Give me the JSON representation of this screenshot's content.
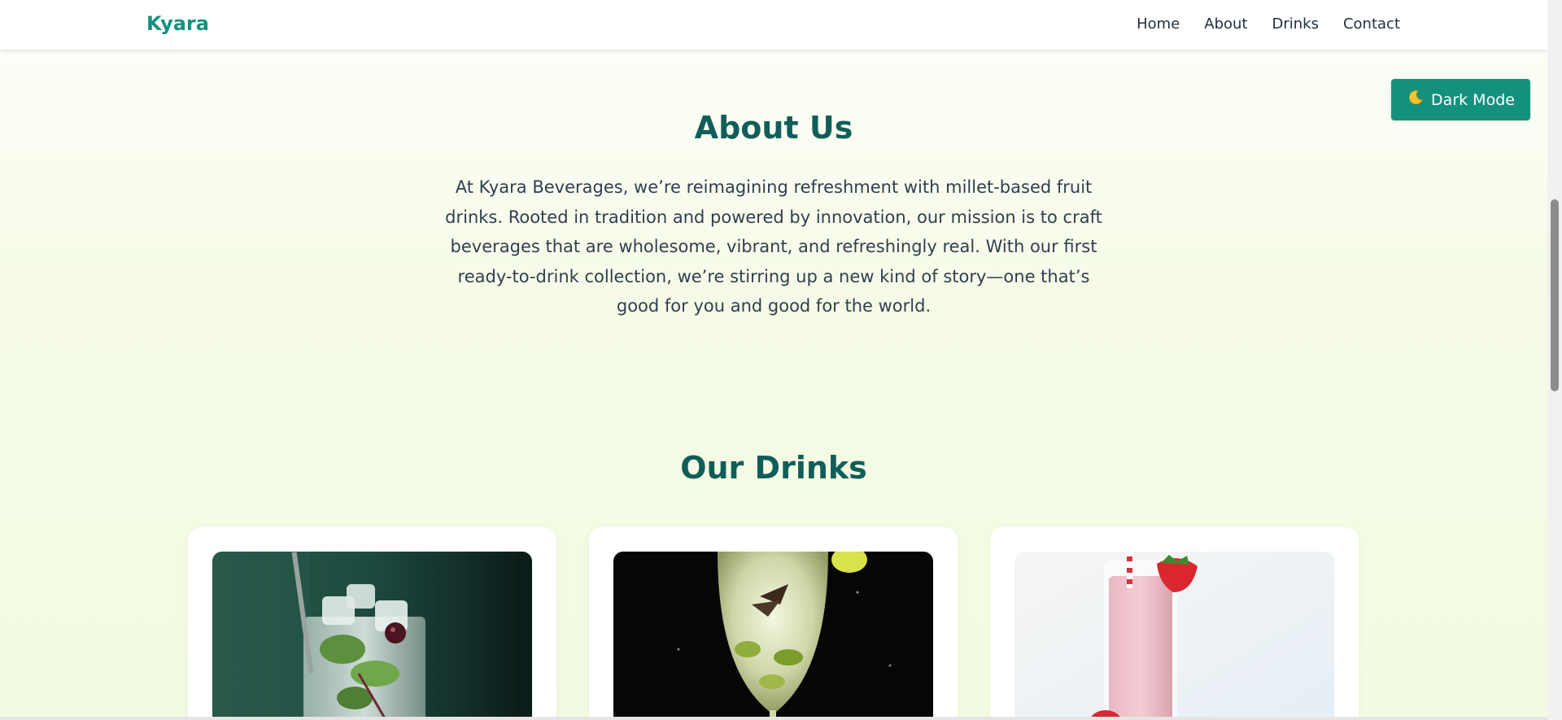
{
  "nav": {
    "brand": "Kyara",
    "links": [
      "Home",
      "About",
      "Drinks",
      "Contact"
    ]
  },
  "theme_toggle": {
    "icon": "moon-icon",
    "label": "Dark Mode"
  },
  "about": {
    "title": "About Us",
    "text": "At Kyara Beverages, we’re reimagining refreshment with millet-based fruit drinks. Rooted in tradition and powered by innovation, our mission is to craft beverages that are wholesome, vibrant, and refreshingly real. With our first ready-to-drink collection, we’re stirring up a new kind of story—one that’s good for you and good for the world."
  },
  "drinks": {
    "title": "Our Drinks",
    "cards": [
      {
        "image": "mint-mojito-glass-image"
      },
      {
        "image": "lime-cocktail-glass-image"
      },
      {
        "image": "strawberry-smoothie-image"
      }
    ]
  },
  "colors": {
    "accent": "#14917e",
    "heading": "#115e59",
    "text": "#2f3f4f",
    "background": "#f4fbe6"
  }
}
